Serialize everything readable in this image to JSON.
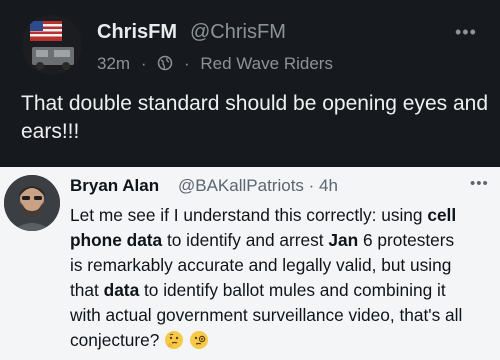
{
  "top_post": {
    "name": "ChrisFM",
    "handle": "@ChrisFM",
    "time": "32m",
    "community": "Red Wave Riders",
    "text": "That double standard should be opening eyes and ears!!!",
    "more": "•••",
    "avatar_icon": "flag-truck-avatar",
    "community_icon": "globe-icon"
  },
  "quoted_tweet": {
    "name": "Bryan Alan",
    "handle": "@BAKallPatriots · 4h",
    "more": "•••",
    "avatar_icon": "bearded-man-avatar",
    "segments": {
      "s1": "Let me see if I understand this correctly: using ",
      "b1": "cell",
      "b2": "phone data",
      "s2": " to identify and arrest ",
      "b3": "Jan",
      "s3": " 6 protesters",
      "s4": "is remarkably accurate and legally valid, but using",
      "s5": "that ",
      "b4": "data",
      "s6": " to identify ballot mules and combining it",
      "s7": "with actual government surveillance video, that's all",
      "s8": "conjecture?"
    },
    "emojis": [
      "thinking-face-emoji",
      "face-with-monocle-emoji"
    ]
  },
  "colors": {
    "dark_bg": "#16191d",
    "card_bg": "#f4f5f6",
    "muted_text": "#8b9399"
  }
}
